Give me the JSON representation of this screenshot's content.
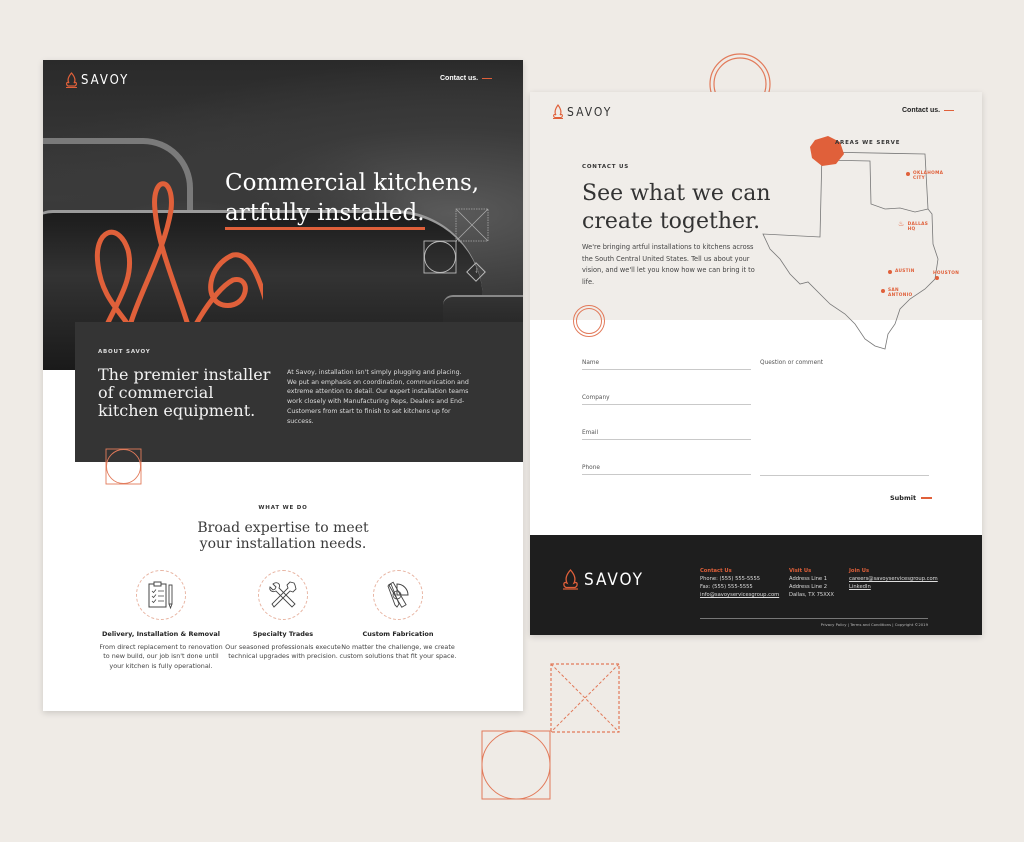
{
  "brand": {
    "name": "SAVOY",
    "accent_color": "#e0603a",
    "dark_color": "#343434"
  },
  "left_page": {
    "header": {
      "logo_text": "SAVOY",
      "contact_link": "Contact us."
    },
    "hero": {
      "title_line1": "Commercial kitchens,",
      "title_line2": "artfully installed."
    },
    "about": {
      "eyebrow": "ABOUT SAVOY",
      "title": "The premier installer of commercial kitchen equipment.",
      "body": "At Savoy, installation isn't simply plugging and placing. We put an emphasis on coordination, communication and extreme attention to detail. Our expert installation teams work closely with Manufacturing Reps, Dealers and End-Customers from start to finish to set kitchens up for success."
    },
    "what_we_do": {
      "eyebrow": "WHAT WE DO",
      "title": "Broad expertise to meet your installation needs.",
      "services": [
        {
          "icon": "clipboard-icon",
          "title": "Delivery, Installation & Removal",
          "body": "From direct replacement to renovation to new build, our job isn't done until your kitchen is fully operational."
        },
        {
          "icon": "wrench-icon",
          "title": "Specialty Trades",
          "body": "Our seasoned professionals execute technical upgrades with precision."
        },
        {
          "icon": "protractor-icon",
          "title": "Custom Fabrication",
          "body": "No matter the challenge, we create custom solutions that fit your space."
        }
      ]
    }
  },
  "right_page": {
    "header": {
      "logo_text": "SAVOY",
      "contact_link": "Contact us."
    },
    "contact": {
      "eyebrow": "CONTACT US",
      "title_line1": "See what we can",
      "title_line2": "create together.",
      "body": "We're bringing artful installations to kitchens across the South Central United States. Tell us about your vision, and we'll let you know how we can bring it to life."
    },
    "map": {
      "title": "AREAS WE SERVE",
      "cities": [
        {
          "line1": "OKLAHOMA",
          "line2": "CITY"
        },
        {
          "line1": "DALLAS",
          "line2": "HQ"
        },
        {
          "line1": "AUSTIN",
          "line2": ""
        },
        {
          "line1": "HOUSTON",
          "line2": ""
        },
        {
          "line1": "SAN",
          "line2": "ANTONIO"
        }
      ]
    },
    "form": {
      "fields": [
        {
          "label": "Name",
          "value": ""
        },
        {
          "label": "Company",
          "value": ""
        },
        {
          "label": "Email",
          "value": ""
        },
        {
          "label": "Phone",
          "value": ""
        }
      ],
      "comment_label": "Question or comment",
      "submit_label": "Submit"
    },
    "footer": {
      "logo_text": "SAVOY",
      "contact": {
        "heading": "Contact Us",
        "phone": "Phone: (555) 555-5555",
        "fax": "Fax: (555) 555-5555",
        "email": "info@savoyservicesgroup.com"
      },
      "visit": {
        "heading": "Visit Us",
        "line1": "Address Line 1",
        "line2": "Address Line 2",
        "line3": "Dallas, TX 75XXX"
      },
      "join": {
        "heading": "Join Us",
        "email": "careers@savoyservicesgroup.com",
        "linkedin": "LinkedIn"
      },
      "legal": "Privacy Policy | Terms and Conditions | Copyright ©2019"
    }
  }
}
